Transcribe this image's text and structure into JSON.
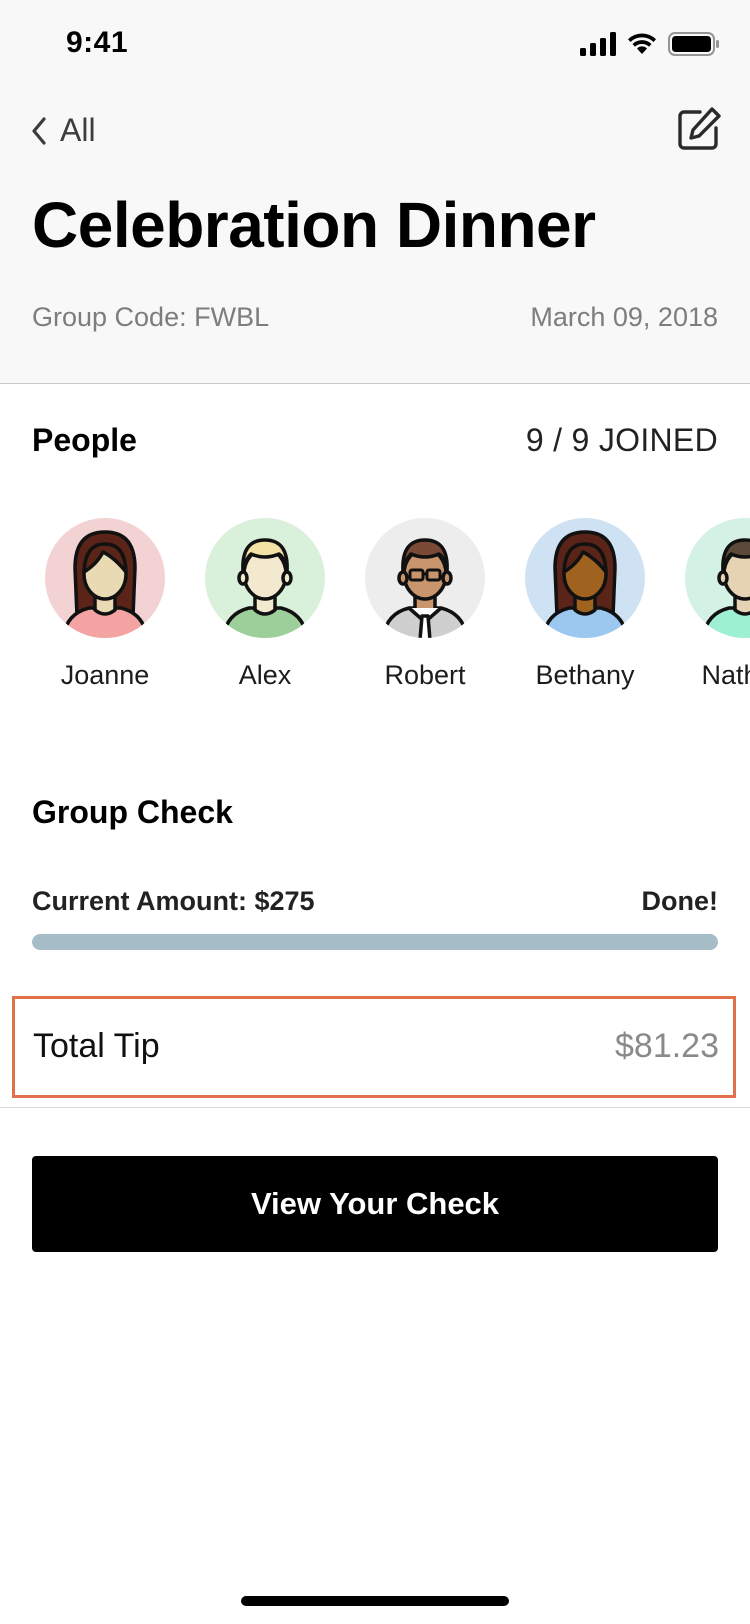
{
  "status_bar": {
    "time": "9:41",
    "icons": [
      "signal-icon",
      "wifi-icon",
      "battery-icon"
    ]
  },
  "nav": {
    "back_label": "All",
    "back_icon": "chevron-left-icon",
    "edit_icon": "compose-icon"
  },
  "header": {
    "title": "Celebration Dinner",
    "group_code": "Group Code: FWBL",
    "date": "March 09, 2018"
  },
  "people": {
    "title": "People",
    "joined": "9 / 9 JOINED",
    "members": [
      {
        "name": "Joanne",
        "bg": "#f3d2d4",
        "hair": "#5a2418",
        "skin": "#e9dab3",
        "shirt": "#f4a3a3"
      },
      {
        "name": "Alex",
        "bg": "#d9f0da",
        "hair": "#f2e3a4",
        "skin": "#f3e9cf",
        "shirt": "#9ccf9a"
      },
      {
        "name": "Robert",
        "bg": "#ededed",
        "hair": "#7a4a36",
        "skin": "#c9956c",
        "shirt": "#cfcfcf"
      },
      {
        "name": "Bethany",
        "bg": "#cfe2f3",
        "hair": "#5a2418",
        "skin": "#a0621f",
        "shirt": "#9cc8f0"
      },
      {
        "name": "Nathan",
        "bg": "#d3f1e4",
        "hair": "#5b4a3a",
        "skin": "#e5d3b3",
        "shirt": "#9ef0d2"
      }
    ]
  },
  "group_check": {
    "title": "Group Check",
    "current_amount": "Current Amount: $275",
    "status": "Done!",
    "progress": 1.0,
    "progress_color": "#a6bdc8"
  },
  "tip": {
    "label": "Total Tip",
    "value": "$81.23",
    "highlight_color": "#e0714a"
  },
  "actions": {
    "view_check": "View Your Check"
  }
}
